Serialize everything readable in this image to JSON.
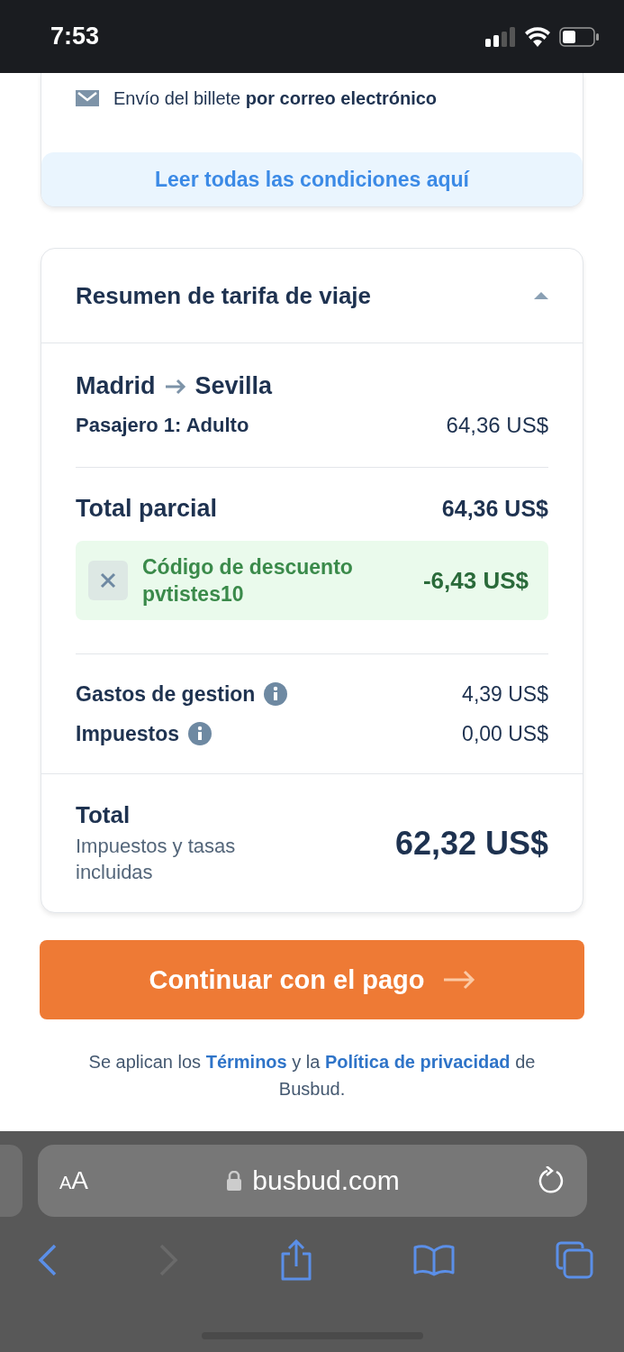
{
  "status_bar": {
    "time": "7:53"
  },
  "delivery": {
    "text": "Envío del billete **por correo electrónico**"
  },
  "conditions_link": "Leer todas las condiciones aquí",
  "summary": {
    "title": "Resumen de tarifa de viaje",
    "expanded": true,
    "route": {
      "origin": "Madrid",
      "destination": "Sevilla"
    },
    "passengers": [
      {
        "label": "Pasajero 1: Adulto",
        "price": "64,36 US$"
      }
    ],
    "subtotal": {
      "label": "Total parcial",
      "amount": "64,36 US$"
    },
    "discount": {
      "label": "Código de descuento",
      "code": "pvtistes10",
      "amount": "-6,43 US$"
    },
    "fees": [
      {
        "label": "Gastos de gestion",
        "amount": "4,39 US$"
      },
      {
        "label": "Impuestos",
        "amount": "0,00 US$"
      }
    ],
    "total": {
      "label": "Total",
      "note": "Impuestos y tasas incluidas",
      "amount": "62,32 US$"
    }
  },
  "continue_button": "Continuar con el pago",
  "legal": [
    {
      "kind": "text",
      "text": "Se aplican los "
    },
    {
      "kind": "link",
      "text": "Términos"
    },
    {
      "kind": "text",
      "text": " y la "
    },
    {
      "kind": "link",
      "text": "Política de privacidad"
    },
    {
      "kind": "text",
      "text": " de Busbud."
    }
  ],
  "browser": {
    "text_size": "AA",
    "url": "busbud.com"
  }
}
